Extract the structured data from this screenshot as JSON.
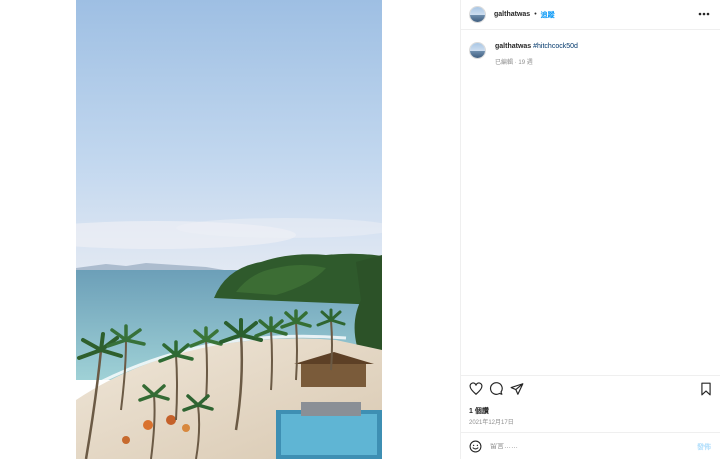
{
  "post": {
    "username": "galthatwas",
    "follow_label": "追蹤",
    "separator": "•",
    "more_icon": "more-horizontal-icon",
    "caption": {
      "username": "galthatwas",
      "hashtag": "#hitchcock50d",
      "edited_label": "已編輯",
      "age": "· 19 週"
    },
    "actions": {
      "like_icon": "heart-icon",
      "comment_icon": "comment-icon",
      "share_icon": "paper-plane-icon",
      "save_icon": "bookmark-icon"
    },
    "likes": "1 個讚",
    "date": "2021年12月17日",
    "comment_box": {
      "emoji_icon": "emoji-smile-icon",
      "placeholder": "留言……",
      "post_label": "發佈"
    }
  },
  "colors": {
    "link": "#0095f6",
    "hashtag": "#00376b",
    "muted": "#8e8e8e",
    "divider": "#efefef"
  }
}
